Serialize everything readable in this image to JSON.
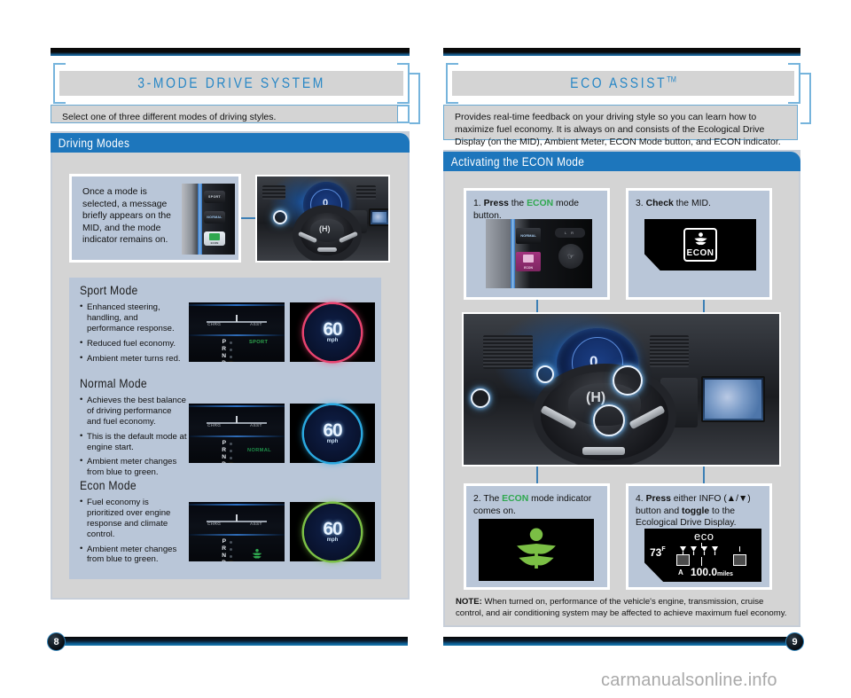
{
  "document": {
    "watermark": "carmanualsonline.info"
  },
  "left_page": {
    "page_number": "8",
    "title": "3-MODE DRIVE SYSTEM",
    "intro": "Select one of three different modes of driving styles.",
    "section": {
      "header": "Driving Modes",
      "callout": {
        "text": "Once a mode is selected, a message briefly appears on the MID, and the mode indicator remains on.",
        "photo_name": "drive-mode-buttons-photo",
        "button_labels": [
          "SPORT",
          "NORMAL",
          "ECON"
        ]
      },
      "dashboard_photo_name": "steering-wheel-dashboard-photo",
      "modes": [
        {
          "name": "Sport Mode",
          "bullets": [
            "Enhanced steering, handling, and performance response.",
            "Reduced fuel economy.",
            "Ambient meter turns red."
          ],
          "mid": {
            "left_label": "CHRG",
            "right_label": "ASST",
            "gear_letters": [
              "P",
              "R",
              "N",
              "D"
            ],
            "active_gear": "D",
            "mode_label": "SPORT",
            "mode_label_color": "#2fa84f"
          },
          "gauge": {
            "speed": "60",
            "unit": "mph",
            "ring_color": "#e8436f"
          }
        },
        {
          "name": "Normal Mode",
          "bullets": [
            "Achieves the best balance of driving performance and fuel economy.",
            "This is the default mode at engine start.",
            "Ambient meter changes from blue to green."
          ],
          "mid": {
            "left_label": "CHRG",
            "right_label": "ASST",
            "gear_letters": [
              "P",
              "R",
              "N",
              "D"
            ],
            "active_gear": "D",
            "mode_label": "NORMAL",
            "mode_label_color": "#1f8f4a"
          },
          "gauge": {
            "speed": "60",
            "unit": "mph",
            "ring_color": "#2aa8e0"
          }
        },
        {
          "name": "Econ Mode",
          "bullets": [
            "Fuel economy is prioritized over engine response and climate control.",
            "Ambient meter changes from blue to green."
          ],
          "mid": {
            "left_label": "CHRG",
            "right_label": "ASST",
            "gear_letters": [
              "P",
              "R",
              "N",
              "D"
            ],
            "active_gear": "D",
            "mode_label": "",
            "mode_label_color": "#2fa84f",
            "leaf_icon": true
          },
          "gauge": {
            "speed": "60",
            "unit": "mph",
            "ring_color": "#7bbf45"
          }
        }
      ]
    }
  },
  "right_page": {
    "page_number": "9",
    "title": "ECO ASSIST",
    "title_trademark": "TM",
    "intro": "Provides real-time feedback on your driving style so you can learn how to maximize fuel economy. It is always on and consists of the Ecological Drive Display (on the MID), Ambient Meter, ECON Mode button, and ECON indicator.",
    "section": {
      "header": "Activating the ECON Mode",
      "steps": [
        {
          "number": "1.",
          "bold": "Press",
          "text_before": " the ",
          "accent": "ECON",
          "text_after": " mode button.",
          "photo_name": "econ-mode-button-photo"
        },
        {
          "number": "3.",
          "bold": "Check",
          "text_before": " the MID.",
          "accent": "",
          "text_after": "",
          "photo_name": "mid-econ-indicator-photo",
          "econ_badge": "ECON"
        },
        {
          "number": "2.",
          "bold": "",
          "text_before": "The ",
          "accent": "ECON",
          "text_after": " mode indicator comes on.",
          "photo_name": "econ-leaf-indicator-photo"
        },
        {
          "number": "4.",
          "bold": "Press",
          "text_before": " either INFO (▲/▼) button and ",
          "bold2": "toggle",
          "text_after": " to the Ecological Drive Display.",
          "photo_name": "ecological-drive-display-photo"
        }
      ],
      "eco_display": {
        "title": "eco",
        "temperature": "73",
        "temperature_unit": "F",
        "odometer": "100.0",
        "odometer_unit": "miles",
        "trip_letter": "A"
      },
      "dashboard_photo_name": "steering-wheel-dashboard-photo",
      "note_label": "NOTE:",
      "note_text": " When turned on, performance of the vehicle's engine, transmission, cruise control, and air conditioning system may be affected to achieve maximum fuel economy."
    }
  },
  "colors": {
    "accent_blue": "#2887c6",
    "header_blue": "#1d76bc",
    "panel_blue": "#b9c6d8",
    "card_gray": "#d4d4d4",
    "econ_green": "#2fa84f"
  }
}
